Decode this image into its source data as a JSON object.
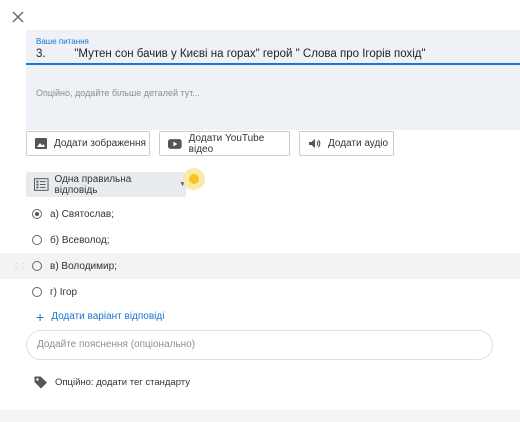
{
  "question": {
    "label": "Ваше питання",
    "value": "3.         \"Мутен сон бачив у Києві на горах\" герой \" Слова про Ігорів похід\"",
    "details_placeholder": "Опційно, додайте більше деталей тут..."
  },
  "media_buttons": [
    {
      "label": "Додати зображення",
      "icon": "image-icon"
    },
    {
      "label": "Додати YouTube відео",
      "icon": "youtube-icon"
    },
    {
      "label": "Додати аудіо",
      "icon": "volume-icon"
    }
  ],
  "question_type": {
    "label": "Одна правильна відповідь",
    "icon": "list-icon"
  },
  "answers": [
    {
      "text": "а) Святослав;",
      "selected": true
    },
    {
      "text": "б) Всеволод;",
      "selected": false
    },
    {
      "text": "в) Володимир;",
      "selected": false
    },
    {
      "text": "г) Ігор",
      "selected": false
    }
  ],
  "add_answer_label": "Додати варіант відповіді",
  "explanation_placeholder": "Додайте пояснення (опціонально)",
  "tag_label": "Опційно: додати тег стандарту",
  "colors": {
    "accent": "#1976d2",
    "highlight": "#f7c325",
    "field_bg": "#eef2f6"
  }
}
